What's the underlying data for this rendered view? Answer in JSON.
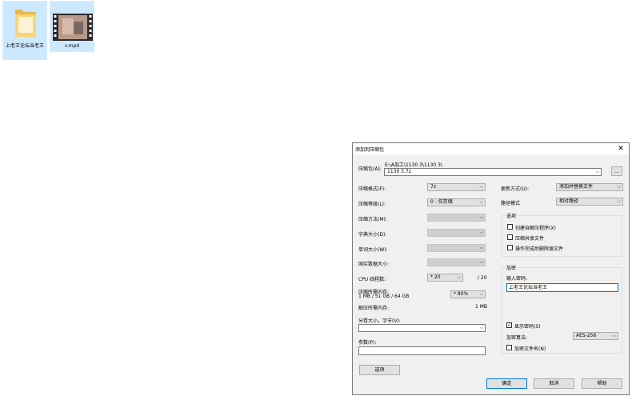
{
  "desktop": {
    "folder_label": "上老王论坛当老王",
    "video_label": "v.mp4"
  },
  "dialog": {
    "title": "添加到压缩包",
    "archive_label": "压缩包(A):",
    "archive_path": "E:\\A加工\\1130 3\\1130 3\\",
    "archive_name": "1130 3.7z",
    "browse_label": "...",
    "format_label": "压缩格式(F):",
    "format_value": "7z",
    "level_label": "压缩等级(L):",
    "level_value": "0 - 仅存储",
    "method_label": "压缩方法(M):",
    "dict_label": "字典大小(D):",
    "word_label": "单词大小(W):",
    "solid_label": "固实数据大小:",
    "cpu_label": "CPU 线程数:",
    "cpu_value": "* 20",
    "cpu_total": "/ 20",
    "mem_label": "压缩所需内存:",
    "mem_value": "1 MB / 51 GB / 64 GB",
    "mem_percent": "* 80%",
    "decomp_label": "解压所需内存:",
    "decomp_value": "1 MB",
    "split_label": "分卷大小，字节(V):",
    "params_label": "参数(P):",
    "options_button": "选项",
    "update_label": "更新方式(U):",
    "update_value": "添加并替换文件",
    "path_label": "路径模式",
    "path_value": "相对路径",
    "options_group": {
      "title": "选项",
      "opt1": "创建自解压程序(X)",
      "opt2": "压缩共享文件",
      "opt3": "操作完成后删除源文件"
    },
    "encrypt_group": {
      "title": "加密",
      "password_label": "输入密码:",
      "password_value": "上老王论坛当老王",
      "show_password": "显示密码(S)",
      "method_label": "加密算法:",
      "method_value": "AES-256",
      "encrypt_names": "加密文件名(N)"
    },
    "ok_button": "确定",
    "cancel_button": "取消",
    "help_button": "帮助"
  }
}
